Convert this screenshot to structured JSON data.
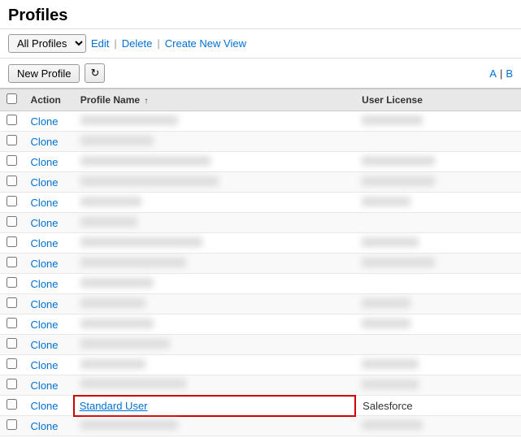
{
  "page": {
    "title": "Profiles",
    "breadcrumb": "Profiles"
  },
  "viewBar": {
    "selectLabel": "All Profiles",
    "editLabel": "Edit",
    "deleteLabel": "Delete",
    "createNewViewLabel": "Create New View"
  },
  "toolbar": {
    "newProfileLabel": "New Profile",
    "refreshTooltip": "Refresh",
    "alphaLinks": [
      "A",
      "B"
    ]
  },
  "table": {
    "columns": {
      "action": "Action",
      "profileName": "Profile Name",
      "userLicense": "User License"
    },
    "rows": [
      {
        "id": 1,
        "action": "Clone",
        "profileName": "",
        "profileNameBlur": true,
        "userLicense": "",
        "userLicenseBlur": true,
        "highlighted": false
      },
      {
        "id": 2,
        "action": "Clone",
        "profileName": "",
        "profileNameBlur": true,
        "userLicense": "",
        "userLicenseBlur": true,
        "highlighted": false
      },
      {
        "id": 3,
        "action": "Clone",
        "profileName": "",
        "profileNameBlur": true,
        "userLicense": "",
        "userLicenseBlur": true,
        "highlighted": false
      },
      {
        "id": 4,
        "action": "Clone",
        "profileName": "",
        "profileNameBlur": true,
        "userLicense": "",
        "userLicenseBlur": true,
        "highlighted": false
      },
      {
        "id": 5,
        "action": "Clone",
        "profileName": "",
        "profileNameBlur": true,
        "userLicense": "",
        "userLicenseBlur": true,
        "highlighted": false
      },
      {
        "id": 6,
        "action": "Clone",
        "profileName": "",
        "profileNameBlur": true,
        "userLicense": "",
        "userLicenseBlur": true,
        "highlighted": false
      },
      {
        "id": 7,
        "action": "Clone",
        "profileName": "",
        "profileNameBlur": true,
        "userLicense": "",
        "userLicenseBlur": true,
        "highlighted": false
      },
      {
        "id": 8,
        "action": "Clone",
        "profileName": "",
        "profileNameBlur": true,
        "userLicense": "",
        "userLicenseBlur": true,
        "highlighted": false
      },
      {
        "id": 9,
        "action": "Clone",
        "profileName": "",
        "profileNameBlur": true,
        "userLicense": "",
        "userLicenseBlur": true,
        "highlighted": false
      },
      {
        "id": 10,
        "action": "Clone",
        "profileName": "",
        "profileNameBlur": true,
        "userLicense": "",
        "userLicenseBlur": true,
        "highlighted": false
      },
      {
        "id": 11,
        "action": "Clone",
        "profileName": "",
        "profileNameBlur": true,
        "userLicense": "",
        "userLicenseBlur": true,
        "highlighted": false
      },
      {
        "id": 12,
        "action": "Clone",
        "profileName": "",
        "profileNameBlur": true,
        "userLicense": "",
        "userLicenseBlur": true,
        "highlighted": false
      },
      {
        "id": 13,
        "action": "Clone",
        "profileName": "",
        "profileNameBlur": true,
        "userLicense": "",
        "userLicenseBlur": true,
        "highlighted": false
      },
      {
        "id": 14,
        "action": "Clone",
        "profileName": "",
        "profileNameBlur": true,
        "userLicense": "",
        "userLicenseBlur": true,
        "highlighted": false
      },
      {
        "id": 15,
        "action": "Clone",
        "profileName": "Standard User",
        "profileNameBlur": false,
        "userLicense": "Salesforce",
        "userLicenseBlur": false,
        "highlighted": true
      },
      {
        "id": 16,
        "action": "Clone",
        "profileName": "",
        "profileNameBlur": true,
        "userLicense": "",
        "userLicenseBlur": true,
        "highlighted": false
      }
    ]
  },
  "blurWidths": {
    "profileNames": [
      "120px",
      "90px",
      "160px",
      "170px",
      "75px",
      "70px",
      "150px",
      "130px",
      "90px",
      "80px",
      "90px",
      "110px",
      "80px",
      "130px",
      "95px"
    ],
    "userLicenses": [
      "75px",
      "0",
      "90px",
      "90px",
      "60px",
      "0",
      "70px",
      "90px",
      "0",
      "60px",
      "60px",
      "0",
      "70px",
      "70px",
      "70px"
    ]
  }
}
